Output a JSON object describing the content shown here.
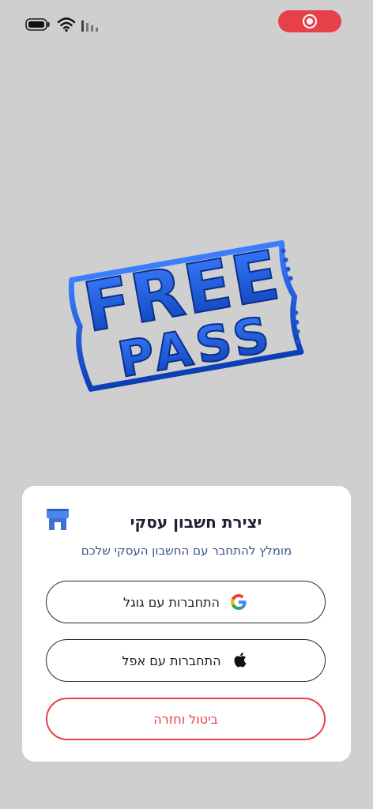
{
  "status_bar": {
    "battery_icon": "battery-icon",
    "wifi_icon": "wifi-icon",
    "signal_icon": "signal-icon",
    "record_icon": "screen-record-icon",
    "record_color": "#e8404a"
  },
  "logo": {
    "top_word": "FREE",
    "bottom_word": "PASS",
    "brand_color": "#1e56d6"
  },
  "sheet": {
    "title": "יצירת חשבון עסקי",
    "title_icon": "store-icon",
    "subtitle": "מומלץ להתחבר עם החשבון העסקי שלכם",
    "google_button_label": "התחברות עם גוגל",
    "apple_button_label": "התחברות עם אפל",
    "cancel_button_label": "ביטול וחזרה",
    "accent_color": "#e8404a",
    "subtitle_color": "#3c4f86"
  }
}
